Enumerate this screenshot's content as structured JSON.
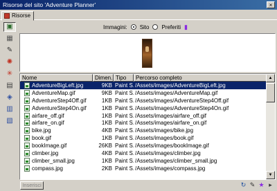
{
  "window": {
    "title": "Risorse del sito 'Adventure Planner'",
    "close_glyph": "×"
  },
  "tab": {
    "label": "Risorse"
  },
  "toolbar": {
    "icons": [
      "images-icon",
      "colors-icon",
      "urls-icon",
      "flash-icon",
      "shockwave-icon",
      "movies-icon",
      "scripts-icon",
      "templates-icon",
      "library-icon"
    ]
  },
  "filter": {
    "label": "Immagini:",
    "option_site": "Sito",
    "option_favorites": "Preferiti",
    "selected": "Sito"
  },
  "list": {
    "columns": [
      "Nome",
      "Dimen...",
      "Tipo",
      "Percorso completo"
    ],
    "rows": [
      {
        "name": "AdventureBigLeft.jpg",
        "size": "9KB",
        "type": "Paint S...",
        "path": "/Assets/images/AdventureBigLeft.jpg",
        "selected": true
      },
      {
        "name": "AdventureMap.gif",
        "size": "9KB",
        "type": "Paint S...",
        "path": "/Assets/images/AdventureMap.gif",
        "selected": false
      },
      {
        "name": "AdventureStep4Off.gif",
        "size": "1KB",
        "type": "Paint S...",
        "path": "/Assets/images/AdventureStep4Off.gif",
        "selected": false
      },
      {
        "name": "AdventureStep4On.gif",
        "size": "1KB",
        "type": "Paint S...",
        "path": "/Assets/images/AdventureStep4On.gif",
        "selected": false
      },
      {
        "name": "airfare_off.gif",
        "size": "1KB",
        "type": "Paint S...",
        "path": "/Assets/images/airfare_off.gif",
        "selected": false
      },
      {
        "name": "airfare_on.gif",
        "size": "1KB",
        "type": "Paint S...",
        "path": "/Assets/images/airfare_on.gif",
        "selected": false
      },
      {
        "name": "bike.jpg",
        "size": "4KB",
        "type": "Paint S...",
        "path": "/Assets/images/bike.jpg",
        "selected": false
      },
      {
        "name": "book.gif",
        "size": "1KB",
        "type": "Paint S...",
        "path": "/Assets/images/book.gif",
        "selected": false
      },
      {
        "name": "bookImage.gif",
        "size": "26KB",
        "type": "Paint S...",
        "path": "/Assets/images/bookImage.gif",
        "selected": false
      },
      {
        "name": "climber.jpg",
        "size": "4KB",
        "type": "Paint S...",
        "path": "/Assets/images/climber.jpg",
        "selected": false
      },
      {
        "name": "climber_small.jpg",
        "size": "1KB",
        "type": "Paint S...",
        "path": "/Assets/images/climber_small.jpg",
        "selected": false
      },
      {
        "name": "compass.jpg",
        "size": "2KB",
        "type": "Paint S...",
        "path": "/Assets/images/compass.jpg",
        "selected": false
      }
    ]
  },
  "bottom": {
    "insert_label": "Inserisci"
  },
  "colors": {
    "selection": "#0a246a",
    "titlebar": "#0a246a",
    "face": "#d4d0c8"
  }
}
